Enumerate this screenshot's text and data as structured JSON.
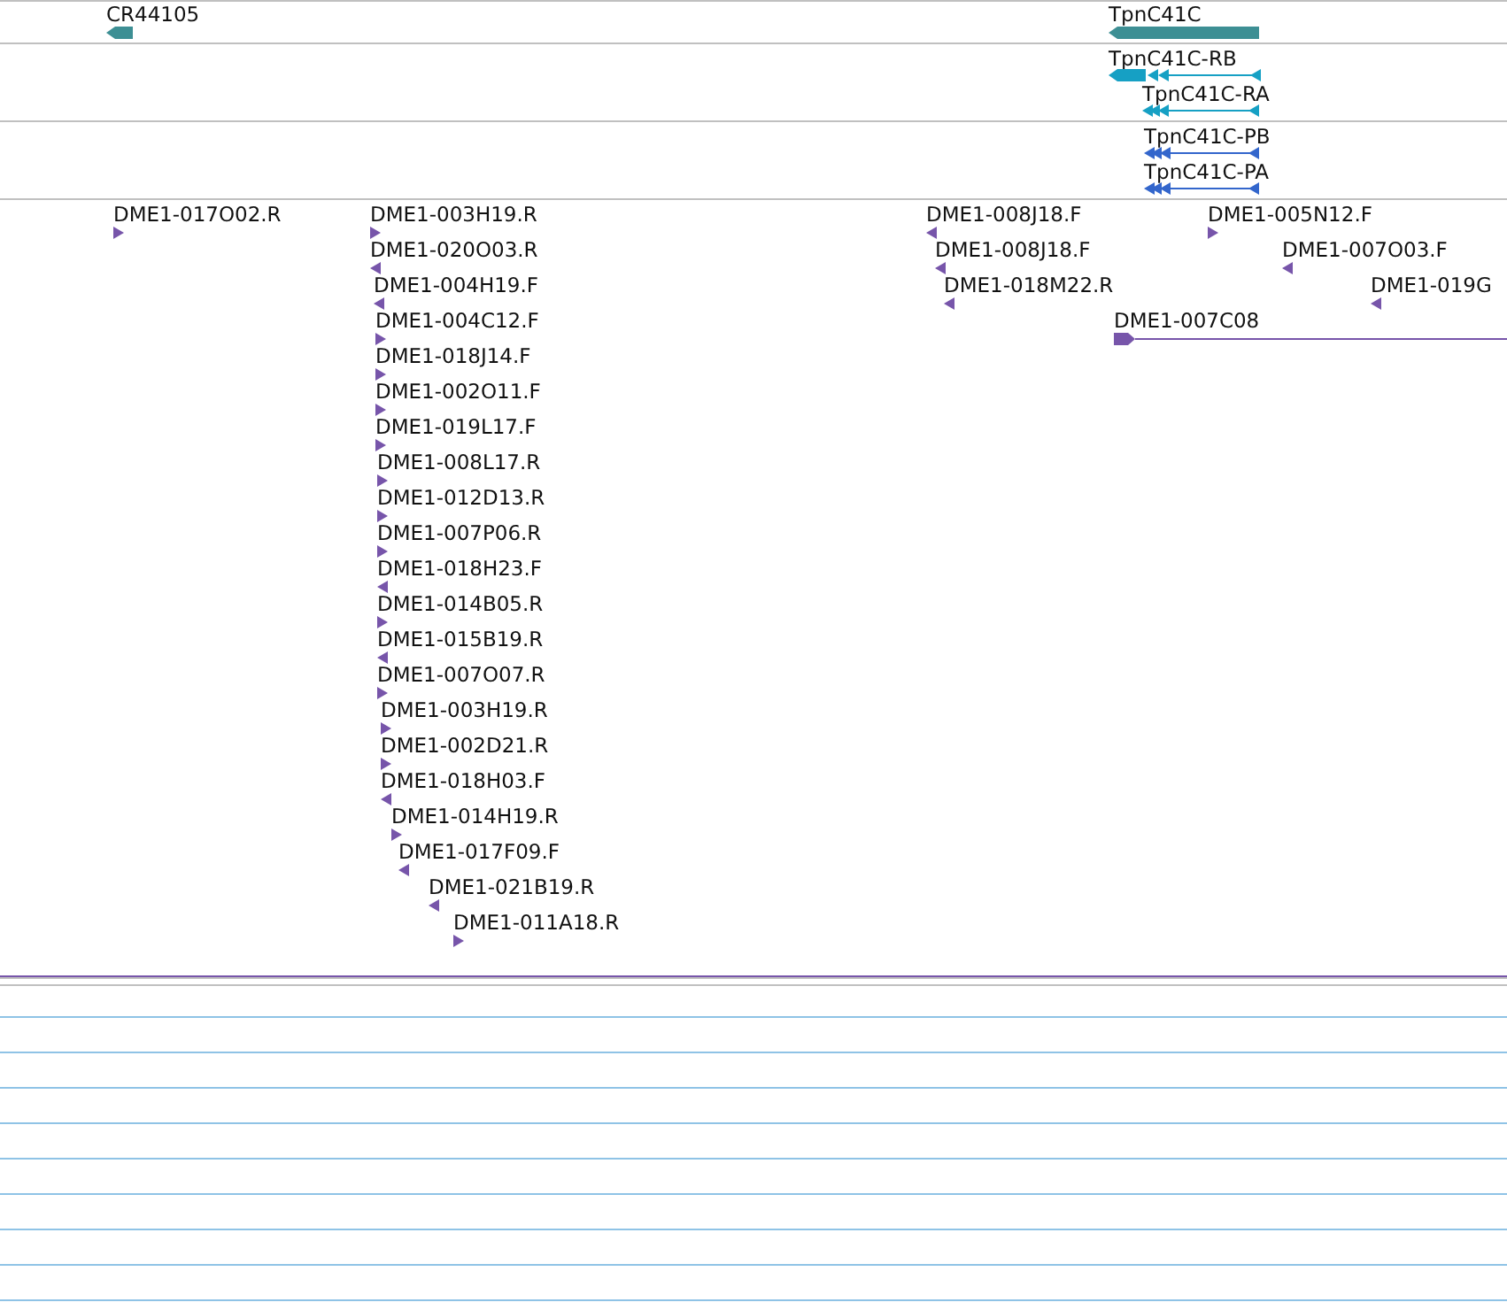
{
  "tracks": [
    {
      "kind": "gene",
      "features": [
        {
          "label": "CR44105",
          "reverse": true
        },
        {
          "label": "TpnC41C",
          "reverse": true
        }
      ]
    },
    {
      "kind": "transcript",
      "features": [
        {
          "label": "TpnC41C-RB",
          "reverse": true
        },
        {
          "label": "TpnC41C-RA",
          "reverse": true
        }
      ]
    },
    {
      "kind": "protein",
      "features": [
        {
          "label": "TpnC41C-PB",
          "reverse": true
        },
        {
          "label": "TpnC41C-PA",
          "reverse": true
        }
      ]
    },
    {
      "kind": "est",
      "features": [
        {
          "label": "DME1-017O02.R",
          "reverse": false
        },
        {
          "label": "DME1-003H19.R",
          "reverse": false
        },
        {
          "label": "DME1-020O03.R",
          "reverse": true
        },
        {
          "label": "DME1-004H19.F",
          "reverse": true
        },
        {
          "label": "DME1-004C12.F",
          "reverse": false
        },
        {
          "label": "DME1-018J14.F",
          "reverse": false
        },
        {
          "label": "DME1-002O11.F",
          "reverse": false
        },
        {
          "label": "DME1-019L17.F",
          "reverse": false
        },
        {
          "label": "DME1-008L17.R",
          "reverse": false
        },
        {
          "label": "DME1-012D13.R",
          "reverse": false
        },
        {
          "label": "DME1-007P06.R",
          "reverse": false
        },
        {
          "label": "DME1-018H23.F",
          "reverse": true
        },
        {
          "label": "DME1-014B05.R",
          "reverse": false
        },
        {
          "label": "DME1-015B19.R",
          "reverse": true
        },
        {
          "label": "DME1-007O07.R",
          "reverse": false
        },
        {
          "label": "DME1-003H19.R",
          "reverse": false
        },
        {
          "label": "DME1-002D21.R",
          "reverse": false
        },
        {
          "label": "DME1-018H03.F",
          "reverse": true
        },
        {
          "label": "DME1-014H19.R",
          "reverse": false
        },
        {
          "label": "DME1-017F09.F",
          "reverse": true
        },
        {
          "label": "DME1-021B19.R",
          "reverse": true
        },
        {
          "label": "DME1-011A18.R",
          "reverse": false
        },
        {
          "label": "DME1-008J18.F",
          "reverse": true
        },
        {
          "label": "DME1-008J18.F",
          "reverse": true
        },
        {
          "label": "DME1-018M22.R",
          "reverse": true
        },
        {
          "label": "DME1-005N12.F",
          "reverse": false
        },
        {
          "label": "DME1-007O03.F",
          "reverse": true
        },
        {
          "label": "DME1-019G",
          "reverse": true
        },
        {
          "label": "DME1-007C08",
          "reverse": false
        }
      ]
    }
  ]
}
